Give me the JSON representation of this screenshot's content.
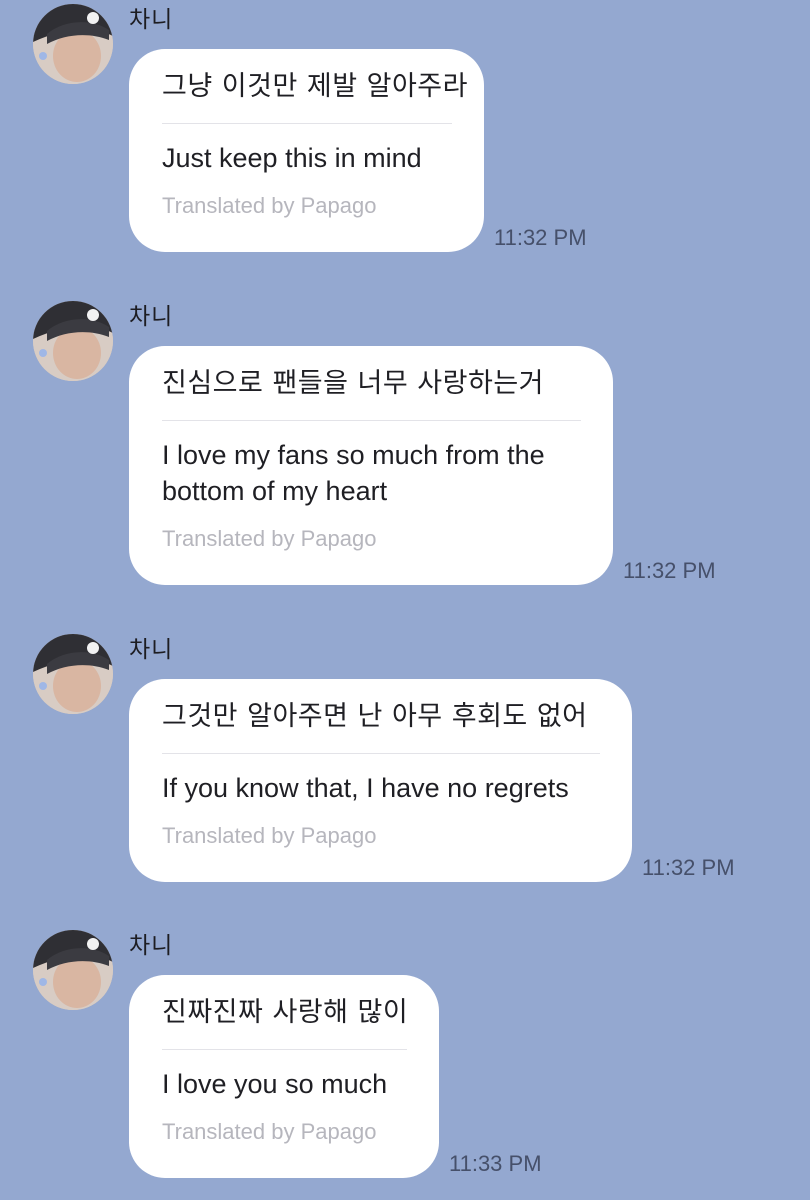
{
  "messages": [
    {
      "sender": "차니",
      "original": "그냥 이것만 제발 알아주라",
      "translation": "Just keep this in mind",
      "translated_by": "Translated by Papago",
      "time": "11:32 PM"
    },
    {
      "sender": "차니",
      "original": "진심으로 팬들을 너무 사랑하는거",
      "translation": "I love my fans so much from the bottom of my heart",
      "translated_by": "Translated by Papago",
      "time": "11:32 PM"
    },
    {
      "sender": "차니",
      "original": "그것만 알아주면 난 아무 후회도 없어",
      "translation": "If you know that, I have no regrets",
      "translated_by": "Translated by Papago",
      "time": "11:32 PM"
    },
    {
      "sender": "차니",
      "original": "진짜진짜 사랑해 많이",
      "translation": "I love you so much",
      "translated_by": "Translated by Papago",
      "time": "11:33 PM"
    }
  ],
  "colors": {
    "background": "#94a8d0",
    "bubble": "#ffffff",
    "translated_by": "#b6b6bd",
    "timestamp": "#46506a"
  },
  "icons": {
    "avatar": "profile-photo"
  }
}
